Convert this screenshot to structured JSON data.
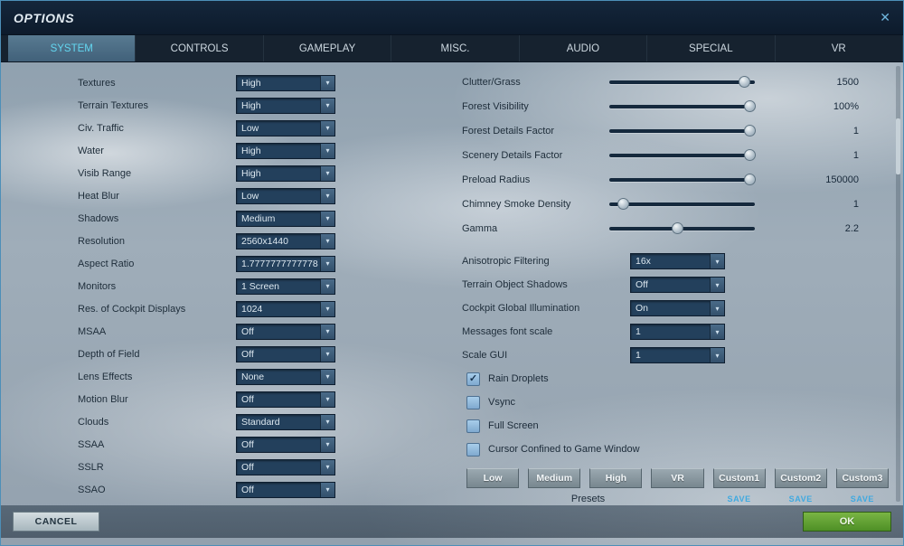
{
  "window": {
    "title": "OPTIONS"
  },
  "icons": {
    "close": "✕",
    "chevron_down": "▾",
    "check": "✓"
  },
  "colors": {
    "accent_cyan": "#63d6f0",
    "ok_green": "#5a9e32",
    "save_blue": "#3fa9e0"
  },
  "tabs": [
    {
      "label": "SYSTEM",
      "active": true
    },
    {
      "label": "CONTROLS",
      "active": false
    },
    {
      "label": "GAMEPLAY",
      "active": false
    },
    {
      "label": "MISC.",
      "active": false
    },
    {
      "label": "AUDIO",
      "active": false
    },
    {
      "label": "SPECIAL",
      "active": false
    },
    {
      "label": "VR",
      "active": false
    }
  ],
  "left_settings": [
    {
      "label": "Textures",
      "value": "High"
    },
    {
      "label": "Terrain Textures",
      "value": "High"
    },
    {
      "label": "Civ. Traffic",
      "value": "Low"
    },
    {
      "label": "Water",
      "value": "High"
    },
    {
      "label": "Visib Range",
      "value": "High"
    },
    {
      "label": "Heat Blur",
      "value": "Low"
    },
    {
      "label": "Shadows",
      "value": "Medium"
    },
    {
      "label": "Resolution",
      "value": "2560x1440"
    },
    {
      "label": "Aspect Ratio",
      "value": "1.7777777777778"
    },
    {
      "label": "Monitors",
      "value": "1 Screen"
    },
    {
      "label": "Res. of Cockpit Displays",
      "value": "1024"
    },
    {
      "label": "MSAA",
      "value": "Off"
    },
    {
      "label": "Depth of Field",
      "value": "Off"
    },
    {
      "label": "Lens Effects",
      "value": "None"
    },
    {
      "label": "Motion Blur",
      "value": "Off"
    },
    {
      "label": "Clouds",
      "value": "Standard"
    },
    {
      "label": "SSAA",
      "value": "Off"
    },
    {
      "label": "SSLR",
      "value": "Off"
    },
    {
      "label": "SSAO",
      "value": "Off"
    }
  ],
  "sliders": [
    {
      "label": "Clutter/Grass",
      "value": "1500",
      "percent": 93
    },
    {
      "label": "Forest Visibility",
      "value": "100%",
      "percent": 97
    },
    {
      "label": "Forest Details Factor",
      "value": "1",
      "percent": 97
    },
    {
      "label": "Scenery Details Factor",
      "value": "1",
      "percent": 97
    },
    {
      "label": "Preload Radius",
      "value": "150000",
      "percent": 97
    },
    {
      "label": "Chimney Smoke Density",
      "value": "1",
      "percent": 10
    },
    {
      "label": "Gamma",
      "value": "2.2",
      "percent": 47
    }
  ],
  "right_dropdowns": [
    {
      "label": "Anisotropic Filtering",
      "value": "16x"
    },
    {
      "label": "Terrain Object Shadows",
      "value": "Off"
    },
    {
      "label": "Cockpit Global Illumination",
      "value": "On"
    },
    {
      "label": "Messages font scale",
      "value": "1"
    },
    {
      "label": "Scale GUI",
      "value": "1"
    }
  ],
  "checkboxes": [
    {
      "label": "Rain Droplets",
      "checked": true
    },
    {
      "label": "Vsync",
      "checked": false
    },
    {
      "label": "Full Screen",
      "checked": false
    },
    {
      "label": "Cursor Confined to Game Window",
      "checked": false
    }
  ],
  "presets": {
    "caption": "Presets",
    "buttons": [
      {
        "label": "Low"
      },
      {
        "label": "Medium"
      },
      {
        "label": "High"
      },
      {
        "label": "VR"
      },
      {
        "label": "Custom1",
        "save": "SAVE"
      },
      {
        "label": "Custom2",
        "save": "SAVE"
      },
      {
        "label": "Custom3",
        "save": "SAVE"
      }
    ]
  },
  "footer": {
    "cancel": "CANCEL",
    "ok": "OK"
  }
}
